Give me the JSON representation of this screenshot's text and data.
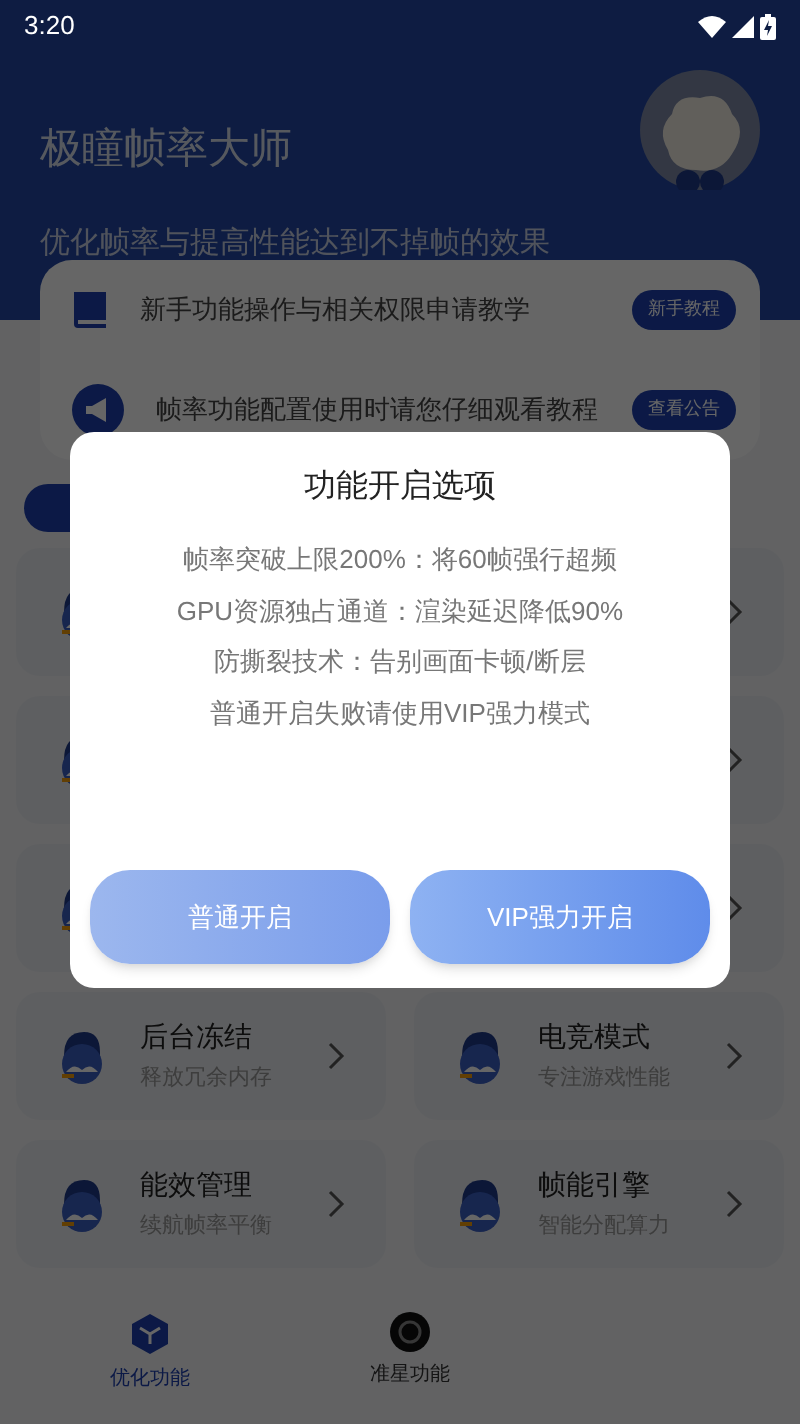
{
  "status_bar": {
    "time": "3:20"
  },
  "header": {
    "title": "极瞳帧率大师",
    "subtitle": "优化帧率与提高性能达到不掉帧的效果"
  },
  "notices": [
    {
      "kind": "book",
      "text": "新手功能操作与相关权限申请教学",
      "badge": "新手教程"
    },
    {
      "kind": "megaphone",
      "text": "帧率功能配置使用时请您仔细观看教程",
      "badge": "查看公告"
    }
  ],
  "cards": [
    {
      "kind": "covered_left"
    },
    {
      "kind": "covered_right"
    },
    {
      "kind": "covered_left"
    },
    {
      "kind": "covered_right"
    },
    {
      "kind": "covered_left"
    },
    {
      "kind": "covered_right"
    },
    {
      "kind": "feature",
      "title": "后台冻结",
      "subtitle": "释放冗余内存"
    },
    {
      "kind": "feature",
      "title": "电竞模式",
      "subtitle": "专注游戏性能"
    },
    {
      "kind": "feature",
      "title": "能效管理",
      "subtitle": "续航帧率平衡"
    },
    {
      "kind": "feature",
      "title": "帧能引擎",
      "subtitle": "智能分配算力"
    }
  ],
  "bottom_nav": [
    {
      "kind": "cube",
      "label": "优化功能",
      "selected": true
    },
    {
      "kind": "gear",
      "label": "准星功能",
      "selected": false
    }
  ],
  "dialog": {
    "title": "功能开启选项",
    "lines": [
      "帧率突破上限200%：将60帧强行超频",
      "GPU资源独占通道：渲染延迟降低90%",
      "防撕裂技术：告别画面卡顿/断层",
      "普通开启失败请使用VIP强力模式"
    ],
    "buttons": [
      {
        "kind": "normal",
        "label": "普通开启"
      },
      {
        "kind": "vip",
        "label": "VIP强力开启"
      }
    ]
  }
}
